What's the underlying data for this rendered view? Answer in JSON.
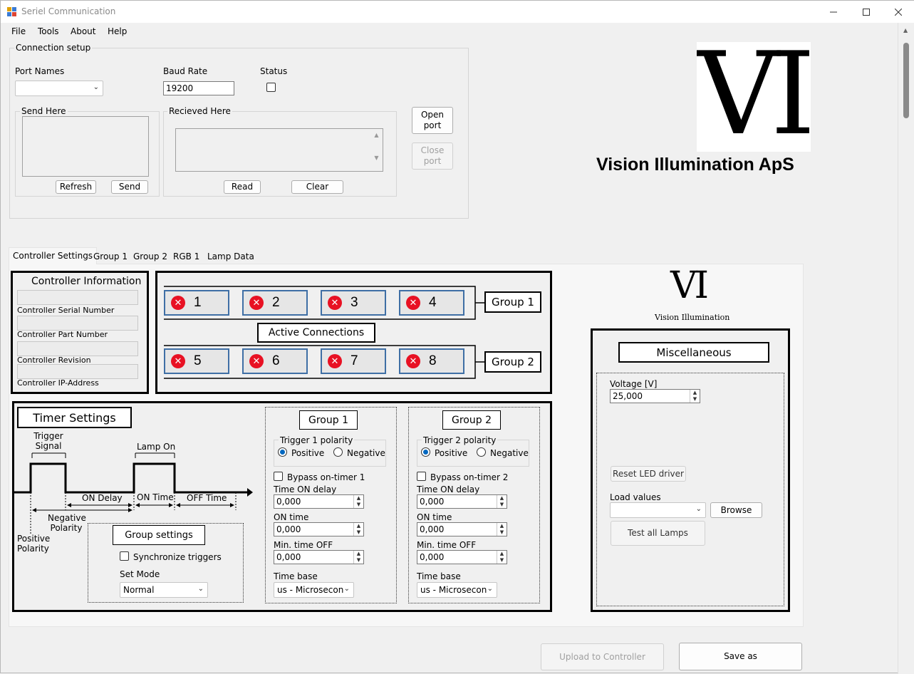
{
  "window": {
    "title": "Seriel Communication"
  },
  "menu": [
    "File",
    "Tools",
    "About",
    "Help"
  ],
  "connection": {
    "group_title": "Connection setup",
    "port_names_label": "Port Names",
    "port_value": "",
    "baud_label": "Baud Rate",
    "baud_value": "19200",
    "status_label": "Status",
    "send_group": "Send Here",
    "received_group": "Recieved Here",
    "refresh": "Refresh",
    "send": "Send",
    "read": "Read",
    "clear": "Clear",
    "open_port": "Open port",
    "close_port": "Close port"
  },
  "brand": {
    "logo": "VI",
    "company": "Vision Illumination ApS",
    "small_logo": "VI",
    "small_caption": "Vision Illumination"
  },
  "tabs": [
    "Controller Settings",
    "Group 1",
    "Group 2",
    "RGB 1",
    "Lamp Data"
  ],
  "controller_info": {
    "title": "Controller Information",
    "fields": [
      "Controller Serial Number",
      "Controller Part Number",
      "Controller Revision",
      "Controller IP-Address"
    ]
  },
  "connections": {
    "title": "Active Connections",
    "group1_label": "Group 1",
    "group2_label": "Group 2",
    "lamps": [
      "1",
      "2",
      "3",
      "4",
      "5",
      "6",
      "7",
      "8"
    ],
    "status_icon": "error-x-icon"
  },
  "timer": {
    "title": "Timer Settings",
    "diagram": {
      "trigger_signal": "Trigger Signal",
      "lamp_on": "Lamp On",
      "on_delay": "ON Delay",
      "on_time": "ON Time",
      "off_time": "OFF Time",
      "negative_polarity": "Negative Polarity",
      "positive_polarity": "Positive Polarity"
    },
    "group_settings": {
      "title": "Group settings",
      "sync": "Synchronize triggers",
      "set_mode_label": "Set Mode",
      "set_mode_value": "Normal"
    },
    "groups": [
      {
        "title": "Group 1",
        "polarity_label": "Trigger 1 polarity",
        "positive": "Positive",
        "negative": "Negative",
        "bypass": "Bypass on-timer 1",
        "on_delay_label": "Time ON delay",
        "on_delay": "0,000",
        "on_time_label": "ON time",
        "on_time": "0,000",
        "min_off_label": "Min. time OFF",
        "min_off": "0,000",
        "time_base_label": "Time base",
        "time_base": "us  - Microsecon"
      },
      {
        "title": "Group 2",
        "polarity_label": "Trigger 2 polarity",
        "positive": "Positive",
        "negative": "Negative",
        "bypass": "Bypass on-timer 2",
        "on_delay_label": "Time ON delay",
        "on_delay": "0,000",
        "on_time_label": "ON time",
        "on_time": "0,000",
        "min_off_label": "Min. time OFF",
        "min_off": "0,000",
        "time_base_label": "Time base",
        "time_base": "us  - Microsecon"
      }
    ]
  },
  "misc": {
    "title": "Miscellaneous",
    "voltage_label": "Voltage [V]",
    "voltage": "25,000",
    "reset": "Reset LED driver",
    "load_label": "Load values",
    "load_value": "",
    "browse": "Browse",
    "test_all": "Test all Lamps"
  },
  "footer": {
    "upload": "Upload to Controller",
    "save_as": "Save as"
  }
}
